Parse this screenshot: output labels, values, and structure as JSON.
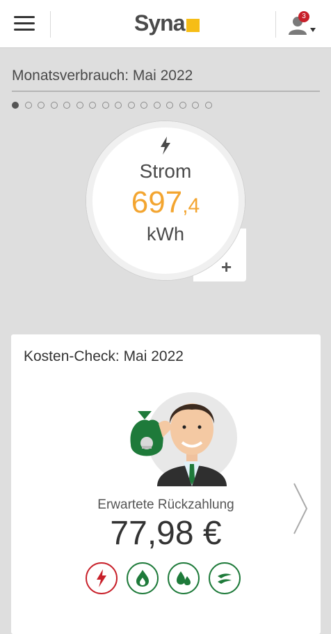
{
  "header": {
    "logo_text": "Syna",
    "logo_accent": "#f6bd16",
    "notification_count": "3"
  },
  "overview": {
    "title": "Monatsverbrauch: Mai 2022",
    "page_count": 16,
    "active_page": 1
  },
  "gauge": {
    "icon": "lightning-icon",
    "label": "Strom",
    "value_int": "697",
    "value_sep": ",",
    "value_dec": "4",
    "unit": "kWh",
    "value_color": "#f3a530",
    "add_label": "+"
  },
  "card": {
    "title": "Kosten-Check: Mai 2022",
    "subtitle": "Erwartete Rückzahlung",
    "amount": "77,98 €",
    "energy_icons": [
      {
        "name": "strom-icon",
        "color": "#c8202a"
      },
      {
        "name": "gas-icon",
        "color": "#1e7a3a"
      },
      {
        "name": "water-icon",
        "color": "#1e7a3a"
      },
      {
        "name": "heat-icon",
        "color": "#1e7a3a"
      }
    ]
  }
}
